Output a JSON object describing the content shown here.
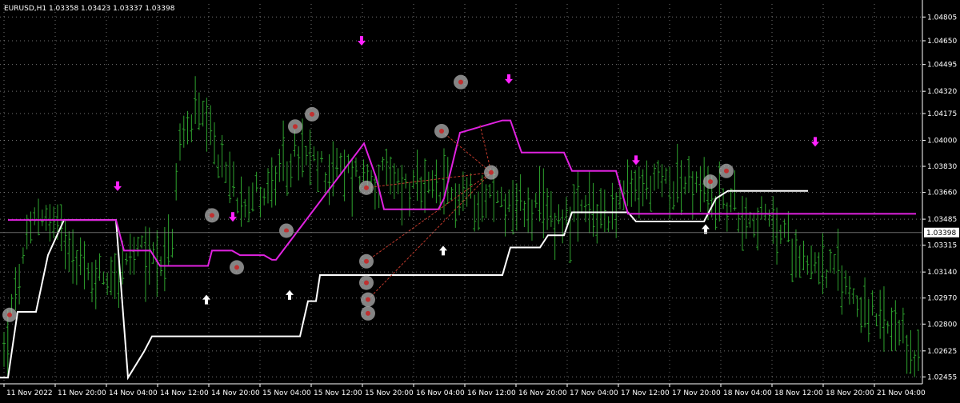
{
  "window": {
    "symbol_info": "EURUSD,H1  1.03358 1.03423 1.03337 1.03398"
  },
  "colors": {
    "background": "#000000",
    "grid": "#c8c8c8",
    "axis_text": "#ffffff",
    "bar": "#2ea22e",
    "white_line": "#ffffff",
    "magenta_line": "#e022e0",
    "arrow_down": "#ff22ff",
    "arrow_up": "#ffffff",
    "marker_fill": "#b0b0b0",
    "trend_line": "#c0392b",
    "price_line": "#888888",
    "price_label_bg": "#ffffff",
    "price_label_text": "#000000"
  },
  "chart_data": {
    "type": "bar",
    "title": "EURUSD,H1",
    "ylim": [
      1.0241,
      1.0489
    ],
    "current_price": "1.03398",
    "y_ticks": [
      "1.04805",
      "1.04650",
      "1.04495",
      "1.04320",
      "1.04175",
      "1.04000",
      "1.03830",
      "1.03660",
      "1.03485",
      "1.03315",
      "1.03140",
      "1.02970",
      "1.02800",
      "1.02625",
      "1.02455"
    ],
    "x_ticks": [
      "11 Nov 2022",
      "11 Nov 20:00",
      "14 Nov 04:00",
      "14 Nov 12:00",
      "14 Nov 20:00",
      "15 Nov 04:00",
      "15 Nov 12:00",
      "15 Nov 20:00",
      "16 Nov 04:00",
      "16 Nov 12:00",
      "16 Nov 20:00",
      "17 Nov 04:00",
      "17 Nov 12:00",
      "17 Nov 20:00",
      "18 Nov 04:00",
      "18 Nov 12:00",
      "18 Nov 20:00",
      "21 Nov 04:00"
    ],
    "bar_count": 240,
    "bars_keyframes": [
      [
        0,
        1.0262
      ],
      [
        8,
        1.0305
      ],
      [
        20,
        1.0355
      ],
      [
        40,
        1.0335
      ],
      [
        50,
        1.031
      ],
      [
        70,
        1.0315
      ],
      [
        80,
        1.0325
      ],
      [
        100,
        1.0325
      ],
      [
        105,
        1.0395
      ],
      [
        115,
        1.042
      ],
      [
        125,
        1.0395
      ],
      [
        140,
        1.0365
      ],
      [
        160,
        1.0368
      ],
      [
        175,
        1.039
      ],
      [
        190,
        1.0382
      ],
      [
        230,
        1.0375
      ],
      [
        250,
        1.0365
      ],
      [
        290,
        1.0364
      ],
      [
        330,
        1.035
      ],
      [
        360,
        1.0352
      ],
      [
        380,
        1.0368
      ],
      [
        400,
        1.0375
      ],
      [
        440,
        1.0355
      ],
      [
        460,
        1.0345
      ],
      [
        480,
        1.0325
      ],
      [
        500,
        1.0312
      ],
      [
        520,
        1.0285
      ],
      [
        540,
        1.0265
      ],
      [
        548,
        1.026
      ]
    ],
    "white_line": [
      [
        0,
        1.0245
      ],
      [
        10,
        1.0245
      ],
      [
        22,
        1.0288
      ],
      [
        45,
        1.0288
      ],
      [
        60,
        1.0325
      ],
      [
        80,
        1.0348
      ],
      [
        145,
        1.0348
      ],
      [
        160,
        1.0245
      ],
      [
        180,
        1.0262
      ],
      [
        190,
        1.0272
      ],
      [
        210,
        1.0272
      ],
      [
        375,
        1.0272
      ],
      [
        385,
        1.0295
      ],
      [
        395,
        1.0295
      ],
      [
        400,
        1.0312
      ],
      [
        628,
        1.0312
      ],
      [
        638,
        1.033
      ],
      [
        675,
        1.033
      ],
      [
        685,
        1.0338
      ],
      [
        705,
        1.0338
      ],
      [
        715,
        1.0353
      ],
      [
        785,
        1.0353
      ],
      [
        795,
        1.0347
      ],
      [
        880,
        1.0347
      ],
      [
        895,
        1.0362
      ],
      [
        910,
        1.0367
      ],
      [
        1010,
        1.0367
      ]
    ],
    "magenta_line": [
      [
        10,
        1.0348
      ],
      [
        145,
        1.0348
      ],
      [
        155,
        1.0328
      ],
      [
        188,
        1.0328
      ],
      [
        200,
        1.0318
      ],
      [
        260,
        1.0318
      ],
      [
        265,
        1.0328
      ],
      [
        290,
        1.0328
      ],
      [
        300,
        1.0325
      ],
      [
        330,
        1.0325
      ],
      [
        340,
        1.0322
      ],
      [
        345,
        1.0322
      ],
      [
        455,
        1.0398
      ],
      [
        470,
        1.0376
      ],
      [
        480,
        1.0355
      ],
      [
        548,
        1.0355
      ],
      [
        555,
        1.0362
      ],
      [
        575,
        1.0405
      ],
      [
        628,
        1.0413
      ],
      [
        638,
        1.0413
      ],
      [
        652,
        1.0392
      ],
      [
        705,
        1.0392
      ],
      [
        715,
        1.038
      ],
      [
        770,
        1.038
      ],
      [
        785,
        1.0352
      ],
      [
        1145,
        1.0352
      ]
    ],
    "up_arrows": [
      [
        258,
        1.0296
      ],
      [
        362,
        1.0299
      ],
      [
        554,
        1.0328
      ],
      [
        882,
        1.0342
      ]
    ],
    "down_arrows": [
      [
        147,
        1.037
      ],
      [
        291,
        1.035
      ],
      [
        452,
        1.0465
      ],
      [
        636,
        1.044
      ],
      [
        795,
        1.0387
      ],
      [
        1019,
        1.0399
      ]
    ],
    "markers": [
      [
        12,
        1.0286
      ],
      [
        265,
        1.0351
      ],
      [
        296,
        1.0317
      ],
      [
        358,
        1.0341
      ],
      [
        369,
        1.0409
      ],
      [
        390,
        1.0417
      ],
      [
        458,
        1.0369
      ],
      [
        458,
        1.0321
      ],
      [
        458,
        1.0307
      ],
      [
        460,
        1.0296
      ],
      [
        460,
        1.0287
      ],
      [
        552,
        1.0406
      ],
      [
        576,
        1.0438
      ],
      [
        614,
        1.0379
      ],
      [
        888,
        1.0373
      ],
      [
        908,
        1.038
      ]
    ],
    "trend_lines": [
      [
        458,
        1.0369,
        614,
        1.0379
      ],
      [
        458,
        1.0321,
        614,
        1.0379
      ],
      [
        460,
        1.0296,
        614,
        1.0379
      ],
      [
        552,
        1.0406,
        614,
        1.0379
      ],
      [
        600,
        1.041,
        614,
        1.0379
      ]
    ]
  }
}
